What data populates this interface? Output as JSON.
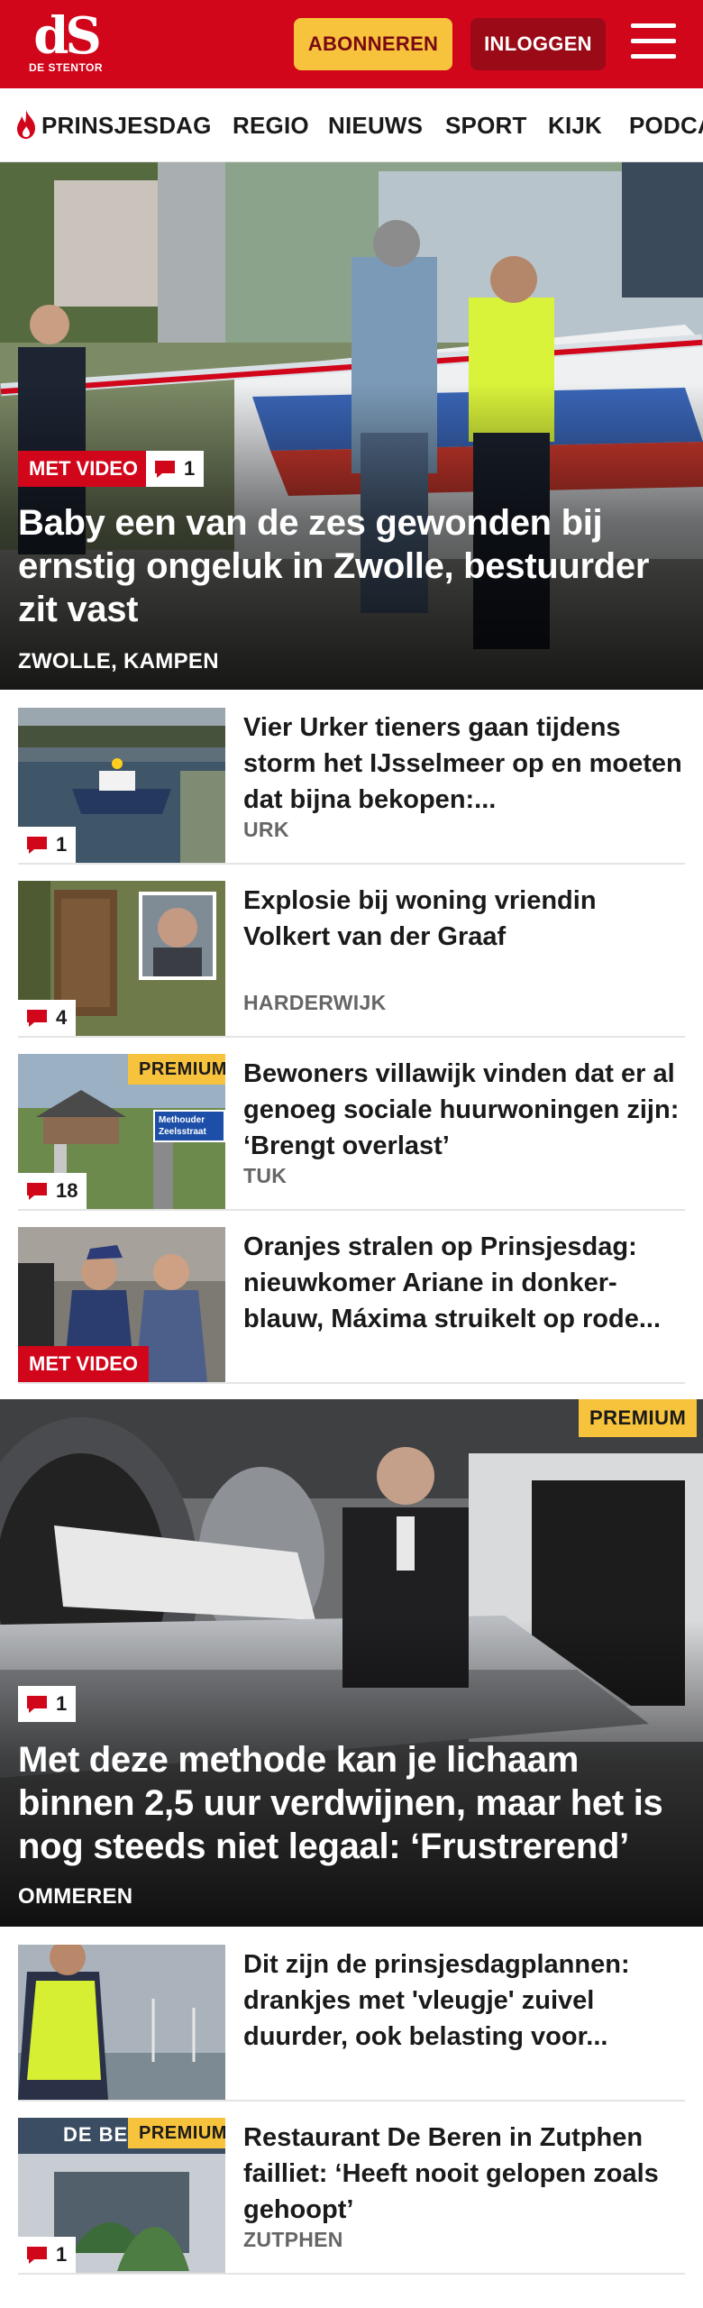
{
  "header": {
    "logo_mark": "dS",
    "logo_sub": "DE STENTOR",
    "subscribe_label": "ABONNEREN",
    "login_label": "INLOGGEN",
    "menu_icon": "hamburger-menu-icon",
    "brand_color": "#d1061b"
  },
  "nav": {
    "items": [
      "PRINSJESDAG",
      "REGIO",
      "NIEUWS",
      "SPORT",
      "KIJK",
      "PODCA"
    ],
    "first_item_icon": "flame-icon"
  },
  "hero": {
    "video_badge": "MET VIDEO",
    "comment_count": "1",
    "title": "Baby een van de zes gewonden bij ernstig ongeluk in Zwolle, bestuurder zit vast",
    "location": "ZWOLLE, KAMPEN"
  },
  "articles": [
    {
      "title": "Vier Urker tieners gaan tijdens storm het IJsselmeer op en moeten dat bijna bekopen:...",
      "location": "URK",
      "comments": "1"
    },
    {
      "title": "Explosie bij woning vriendin Volkert van der Graaf",
      "location": "HARDERWIJK",
      "comments": "4"
    },
    {
      "title": "Bewoners villawijk vinden dat er al genoeg sociale huurwoningen zijn: ‘Brengt overlast’",
      "location": "TUK",
      "comments": "18",
      "premium": "PREMIUM",
      "sign_text": "Methouder Zeelsstraat"
    },
    {
      "title": "Oranjes stralen op Prinsjesdag: nieuwkomer Ariane in donker-blauw, Máxima struikelt op rode...",
      "location": "",
      "video_badge": "MET VIDEO"
    }
  ],
  "feature": {
    "premium": "PREMIUM",
    "comment_count": "1",
    "title": "Met deze methode kan je lichaam binnen 2,5 uur verdwijnen, maar het is nog steeds niet legaal: ‘Frustrerend’",
    "location": "OMMEREN"
  },
  "articles2": [
    {
      "title": "Dit zijn de prinsjesdagplannen: drankjes met 'vleugje' zuivel duurder, ook belasting voor...",
      "location": ""
    },
    {
      "title": "Restaurant De Beren in Zutphen failliet: ‘Heeft nooit gelopen zoals gehoopt’",
      "location": "ZUTPHEN",
      "comments": "1",
      "premium": "PREMIUM",
      "sign_text": "DE BE"
    }
  ]
}
